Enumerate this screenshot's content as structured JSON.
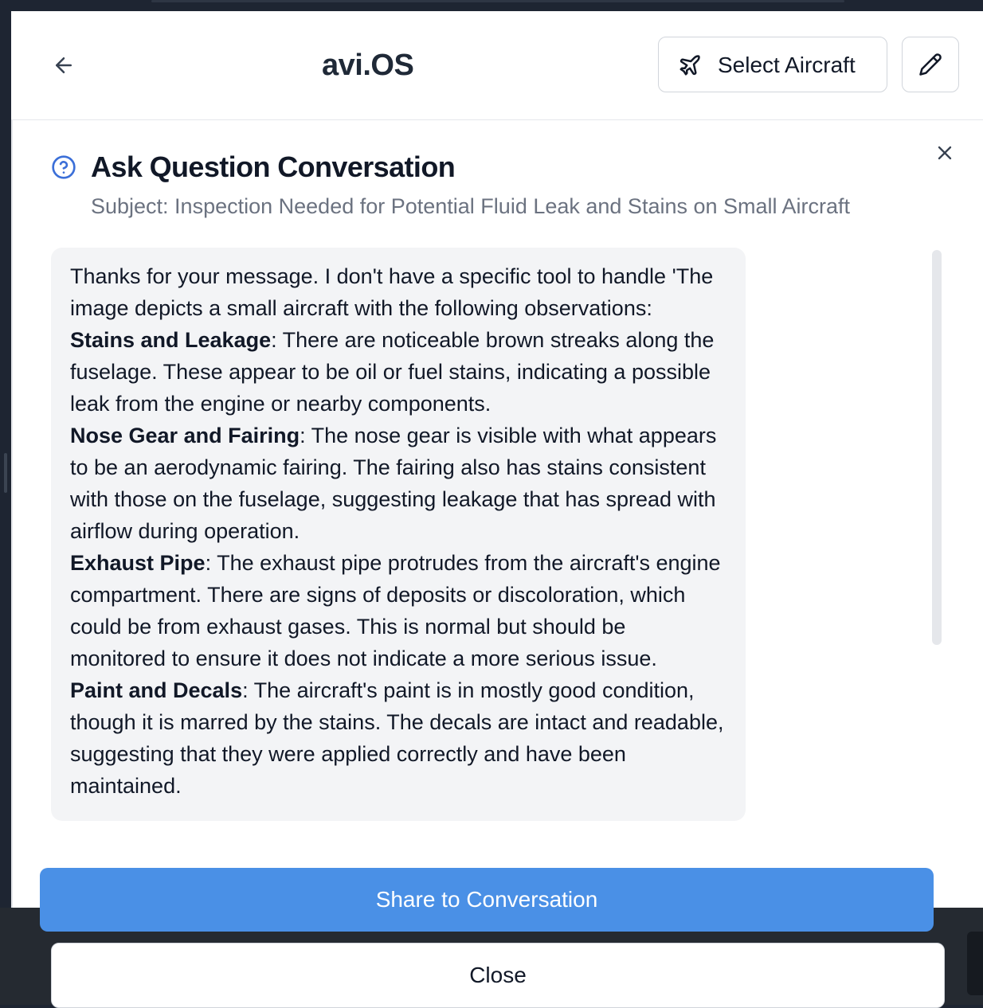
{
  "header": {
    "title": "avi.OS",
    "select_aircraft_label": "Select Aircraft"
  },
  "dialog": {
    "title": "Ask Question Conversation",
    "subject": "Subject: Inspection Needed for Potential Fluid Leak and Stains on Small Aircraft"
  },
  "message": {
    "intro": "Thanks for your message. I don't have a specific tool to handle 'The image depicts a small aircraft with the following observations:",
    "items": [
      {
        "heading": "Stains and Leakage",
        "text": ": There are noticeable brown streaks along the fuselage. These appear to be oil or fuel stains, indicating a possible leak from the engine or nearby components."
      },
      {
        "heading": "Nose Gear and Fairing",
        "text": ": The nose gear is visible with what appears to be an aerodynamic fairing. The fairing also has stains consistent with those on the fuselage, suggesting leakage that has spread with airflow during operation."
      },
      {
        "heading": "Exhaust Pipe",
        "text": ": The exhaust pipe protrudes from the aircraft's engine compartment. There are signs of deposits or discoloration, which could be from exhaust gases. This is normal but should be monitored to ensure it does not indicate a more serious issue."
      },
      {
        "heading": "Paint and Decals",
        "text": ": The aircraft's paint is in mostly good condition, though it is marred by the stains. The decals are intact and readable, suggesting that they were applied correctly and have been maintained."
      }
    ]
  },
  "actions": {
    "share_label": "Share to Conversation",
    "close_label": "Close"
  }
}
